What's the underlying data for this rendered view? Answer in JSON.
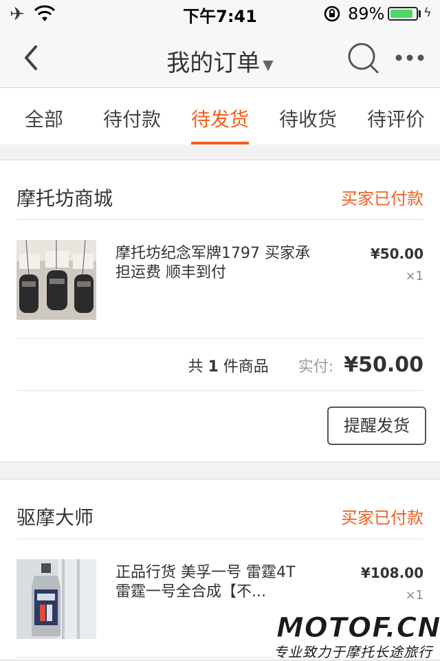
{
  "status_bar": {
    "time": "下午7:41",
    "battery": "89%",
    "battery_level": 0.89
  },
  "nav": {
    "title": "我的订单",
    "icons": [
      "back-icon",
      "search-icon",
      "more-icon"
    ]
  },
  "tabs": [
    "全部",
    "待付款",
    "待发货",
    "待收货",
    "待评价"
  ],
  "active_tab": "待发货",
  "orders": [
    {
      "store": "摩托坊商城",
      "status": "买家已付款",
      "item_title": "摩托坊纪念军牌1797 买家承担运费 顺丰到付",
      "price": "¥50.00",
      "qty": "×1",
      "summary_prefix": "共",
      "summary_count": "1",
      "summary_suffix": "件商品",
      "paid_label": "实付:",
      "paid_amount": "¥50.00",
      "action": "提醒发货"
    },
    {
      "store": "驱摩大师",
      "status": "买家已付款",
      "item_title": "正品行货 美孚一号 雷霆4T 雷霆一号全合成【不...",
      "price": "¥108.00",
      "qty": "×1"
    }
  ],
  "watermark": {
    "main": "MOTOF.CN",
    "sub": "专业致力于摩托长途旅行"
  },
  "colors": {
    "accent": "#f35e1d",
    "battery": "#4cd964"
  }
}
